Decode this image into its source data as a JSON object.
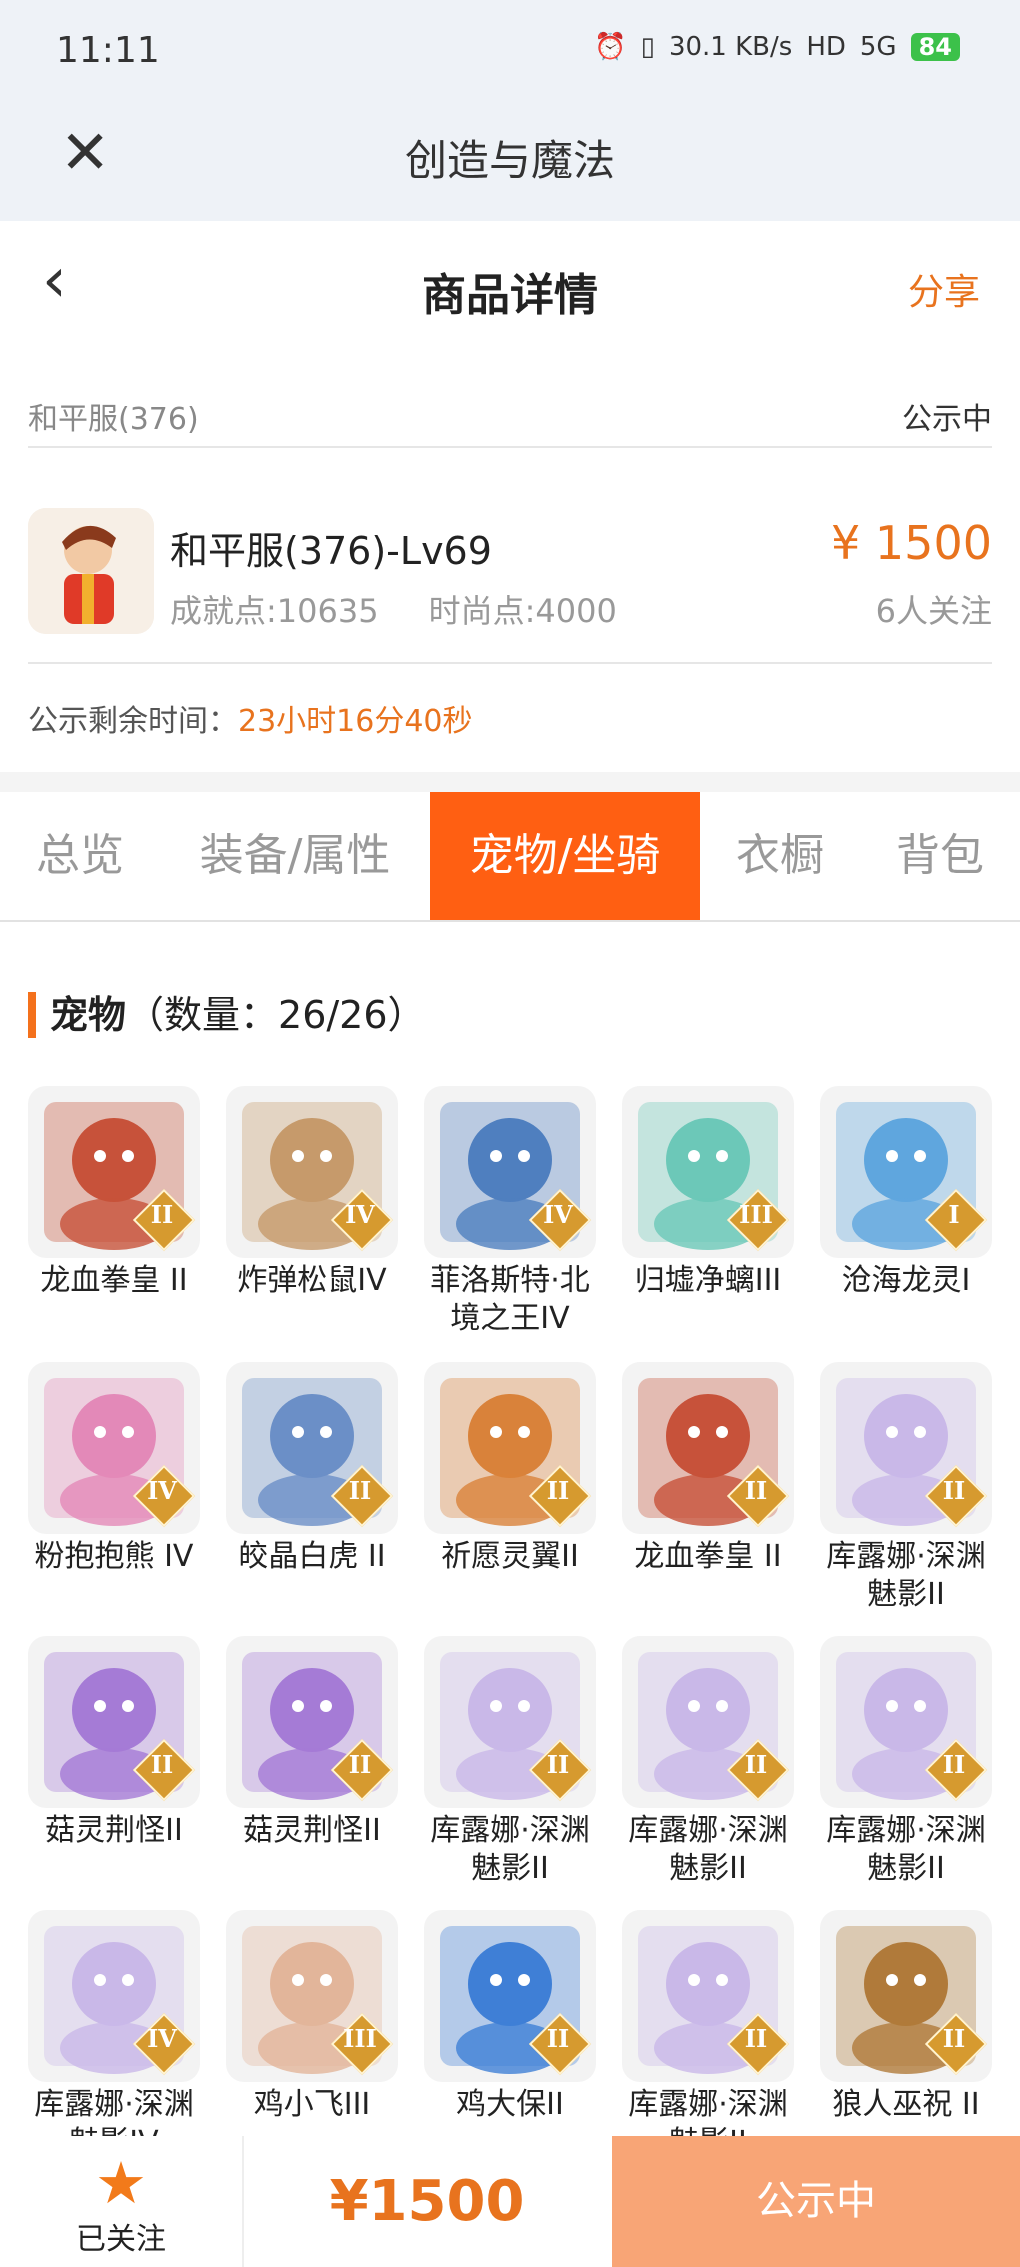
{
  "status_bar": {
    "time": "11:11",
    "network_speed": "30.1 KB/s",
    "hd": "HD",
    "signal": "5G",
    "battery": "84"
  },
  "app_bar": {
    "title": "创造与魔法"
  },
  "nav": {
    "title": "商品详情",
    "share": "分享"
  },
  "server": {
    "name": "和平服(376)",
    "status": "公示中"
  },
  "product": {
    "name": "和平服(376)-Lv69",
    "achievement": "成就点:10635",
    "fashion": "时尚点:4000",
    "price": "¥ 1500",
    "followers": "6人关注"
  },
  "remaining": {
    "label": "公示剩余时间：",
    "value": "23小时16分40秒"
  },
  "tabs": [
    "总览",
    "装备/属性",
    "宠物/坐骑",
    "衣橱",
    "背包"
  ],
  "active_tab": "宠物/坐骑",
  "section": {
    "title": "宠物",
    "count": "（数量：26/26）"
  },
  "pets": [
    {
      "name": "龙血拳皇 II",
      "tier": "II",
      "color": "#c7523a"
    },
    {
      "name": "炸弹松鼠IV",
      "tier": "IV",
      "color": "#c69a6b"
    },
    {
      "name": "菲洛斯特·北境之王IV",
      "tier": "IV",
      "color": "#4f7fbf"
    },
    {
      "name": "归墟净螭III",
      "tier": "III",
      "color": "#6cc8b8"
    },
    {
      "name": "沧海龙灵I",
      "tier": "I",
      "color": "#5fa6de"
    },
    {
      "name": "粉抱抱熊 IV",
      "tier": "IV",
      "color": "#e389b8"
    },
    {
      "name": "皎晶白虎 II",
      "tier": "II",
      "color": "#6b8fc7"
    },
    {
      "name": "祈愿灵翼II",
      "tier": "II",
      "color": "#d9823a"
    },
    {
      "name": "龙血拳皇 II",
      "tier": "II",
      "color": "#c7523a"
    },
    {
      "name": "库露娜·深渊魅影II",
      "tier": "II",
      "color": "#c9b8e8"
    },
    {
      "name": "菇灵荆怪II",
      "tier": "II",
      "color": "#a57bd6"
    },
    {
      "name": "菇灵荆怪II",
      "tier": "II",
      "color": "#a57bd6"
    },
    {
      "name": "库露娜·深渊魅影II",
      "tier": "II",
      "color": "#c9b8e8"
    },
    {
      "name": "库露娜·深渊魅影II",
      "tier": "II",
      "color": "#c9b8e8"
    },
    {
      "name": "库露娜·深渊魅影II",
      "tier": "II",
      "color": "#c9b8e8"
    },
    {
      "name": "库露娜·深渊魅影IV",
      "tier": "IV",
      "color": "#c9b8e8"
    },
    {
      "name": "鸡小飞III",
      "tier": "III",
      "color": "#e2b59a"
    },
    {
      "name": "鸡大保II",
      "tier": "II",
      "color": "#3f7fd6"
    },
    {
      "name": "库露娜·深渊魅影II",
      "tier": "II",
      "color": "#c9b8e8"
    },
    {
      "name": "狼人巫祝 II",
      "tier": "II",
      "color": "#b07a3a"
    }
  ],
  "bottom_bar": {
    "follow_label": "已关注",
    "price": "¥1500",
    "action": "公示中"
  }
}
